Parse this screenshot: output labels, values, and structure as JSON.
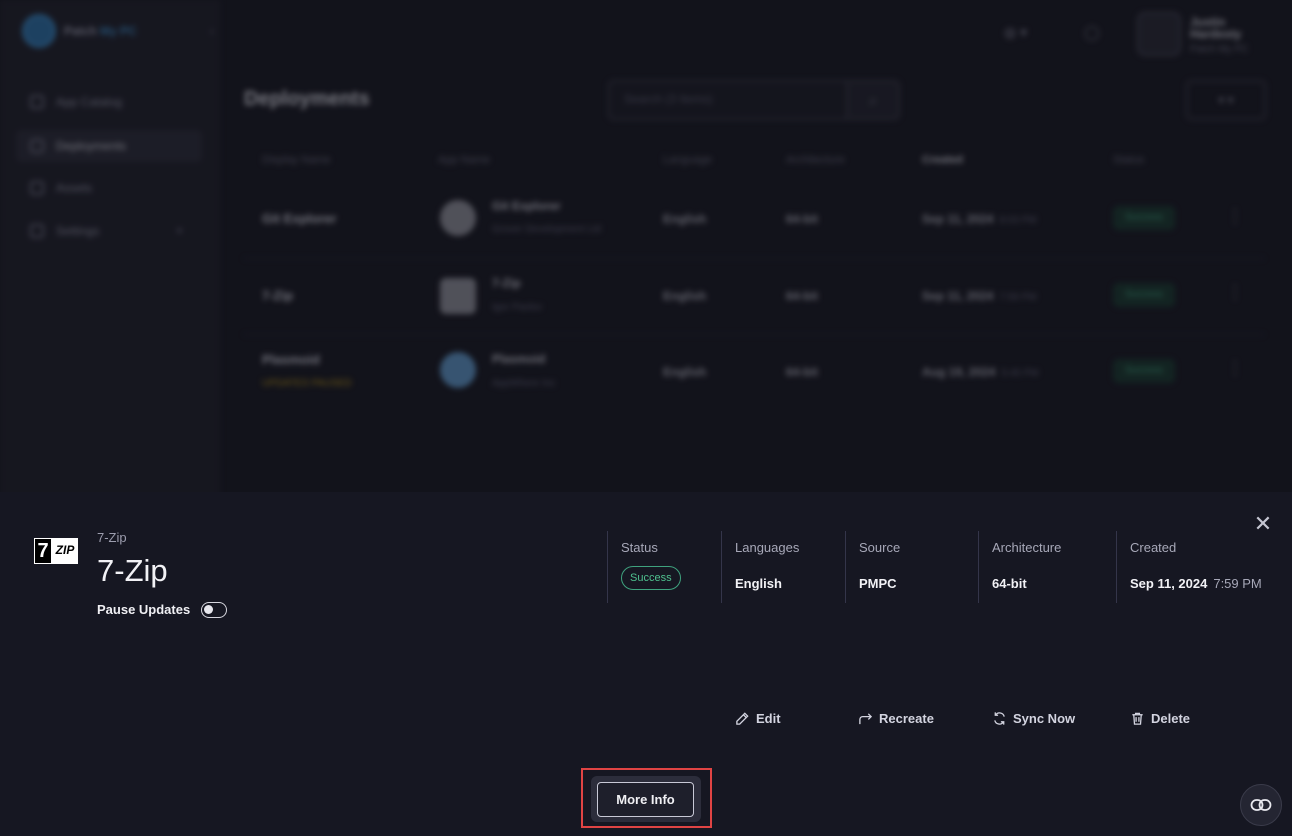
{
  "sidebar": {
    "brand": {
      "name": "Patch",
      "accent": "My PC"
    },
    "items": [
      {
        "label": "App Catalog"
      },
      {
        "label": "Deployments"
      },
      {
        "label": "Assets"
      },
      {
        "label": "Settings"
      }
    ]
  },
  "topbar": {
    "user_name": "Justin Hardesty",
    "user_sub": "Patch My PC"
  },
  "page": {
    "title": "Deployments",
    "search_placeholder": "Search (3 Items)"
  },
  "table": {
    "columns": [
      "Display Name",
      "App Name",
      "Language",
      "Architecture",
      "Created",
      "Status"
    ],
    "rows": [
      {
        "display_name": "Git Explorer",
        "warning": "",
        "app_name": "Git Explorer",
        "vendor": "Grover Development Ltd",
        "language": "English",
        "arch": "64-bit",
        "date": "Sep 11, 2024",
        "time": "8:03 PM",
        "status": "Success"
      },
      {
        "display_name": "7-Zip",
        "warning": "",
        "app_name": "7-Zip",
        "vendor": "Igor Pavlov",
        "language": "English",
        "arch": "64-bit",
        "date": "Sep 11, 2024",
        "time": "7:59 PM",
        "status": "Success"
      },
      {
        "display_name": "Plasmoid",
        "warning": "UPDATES PAUSED",
        "app_name": "Plasmoid",
        "vendor": "AppWhere Inc",
        "language": "English",
        "arch": "64-bit",
        "date": "Aug 19, 2024",
        "time": "5:45 PM",
        "status": "Success"
      }
    ]
  },
  "detail": {
    "logo": {
      "seven": "7",
      "zip": "ZIP"
    },
    "subtitle": "7-Zip",
    "title": "7-Zip",
    "pause_label": "Pause Updates",
    "status_label": "Status",
    "status_value": "Success",
    "languages_label": "Languages",
    "languages_value": "English",
    "source_label": "Source",
    "source_value": "PMPC",
    "architecture_label": "Architecture",
    "architecture_value": "64-bit",
    "created_label": "Created",
    "created_date": "Sep 11, 2024",
    "created_time": "7:59 PM",
    "actions": {
      "edit": "Edit",
      "recreate": "Recreate",
      "sync": "Sync Now",
      "delete": "Delete"
    },
    "more_info": "More Info"
  },
  "colors": {
    "success": "#4fc18f",
    "highlight": "#e04444",
    "warning": "#b9951c"
  }
}
